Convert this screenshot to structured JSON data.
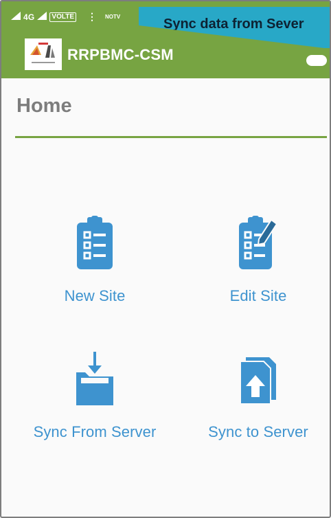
{
  "status_bar": {
    "signal_text": "4G",
    "volte": "VOLTE",
    "more": "⋮",
    "small_tag": "NOTV"
  },
  "banner": {
    "text": "Sync data from Sever"
  },
  "app_bar": {
    "title": "RRPBMC-CSM"
  },
  "page": {
    "title": "Home"
  },
  "menu": {
    "new_site": "New Site",
    "edit_site": "Edit Site",
    "sync_from_server": "Sync From Server",
    "sync_to_server": "Sync to Server"
  },
  "colors": {
    "app_bar": "#77a442",
    "banner": "#28a8c7",
    "icon_blue": "#3e93cf",
    "divider": "#77a442",
    "title_gray": "#7d7d7d"
  }
}
